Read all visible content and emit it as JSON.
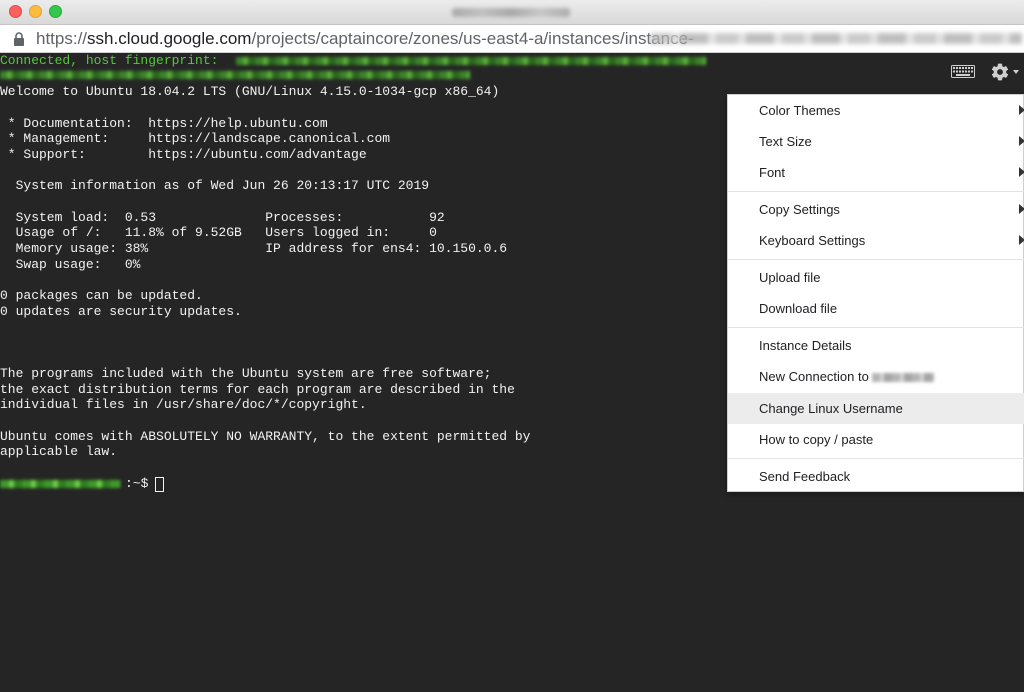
{
  "browser": {
    "url_scheme": "https://",
    "url_host": "ssh.cloud.google.com",
    "url_path": "/projects/captaincore/zones/us-east4-a/instances/instance-"
  },
  "terminal": {
    "connected_label": "Connected, host fingerprint:",
    "welcome": "Welcome to Ubuntu 18.04.2 LTS (GNU/Linux 4.15.0-1034-gcp x86_64)",
    "doc_line": " * Documentation:  https://help.ubuntu.com",
    "mgmt_line": " * Management:     https://landscape.canonical.com",
    "support_line": " * Support:        https://ubuntu.com/advantage",
    "sysinfo_line": "  System information as of Wed Jun 26 20:13:17 UTC 2019",
    "load_line": "  System load:  0.53              Processes:           92",
    "usage_line": "  Usage of /:   11.8% of 9.52GB   Users logged in:     0",
    "memory_line": "  Memory usage: 38%               IP address for ens4: 10.150.0.6",
    "swap_line": "  Swap usage:   0%",
    "packages_line": "0 packages can be updated.",
    "security_line": "0 updates are security updates.",
    "programs_line1": "The programs included with the Ubuntu system are free software;",
    "programs_line2": "the exact distribution terms for each program are described in the",
    "programs_line3": "individual files in /usr/share/doc/*/copyright.",
    "warranty_line1": "Ubuntu comes with ABSOLUTELY NO WARRANTY, to the extent permitted by",
    "warranty_line2": "applicable law.",
    "prompt_suffix": ":~$"
  },
  "menu": {
    "color_themes": "Color Themes",
    "text_size": "Text Size",
    "font": "Font",
    "copy_settings": "Copy Settings",
    "keyboard_settings": "Keyboard Settings",
    "upload_file": "Upload file",
    "download_file": "Download file",
    "instance_details": "Instance Details",
    "new_connection": "New Connection to",
    "change_username": "Change Linux Username",
    "copy_paste": "How to copy / paste",
    "send_feedback": "Send Feedback"
  },
  "icons": {
    "lock": "lock-icon",
    "keyboard": "keyboard-icon",
    "settings": "gear-icon"
  },
  "colors": {
    "terminal_bg": "#252525",
    "terminal_fg": "#f2f2f2",
    "connected_green": "#53c93b"
  }
}
